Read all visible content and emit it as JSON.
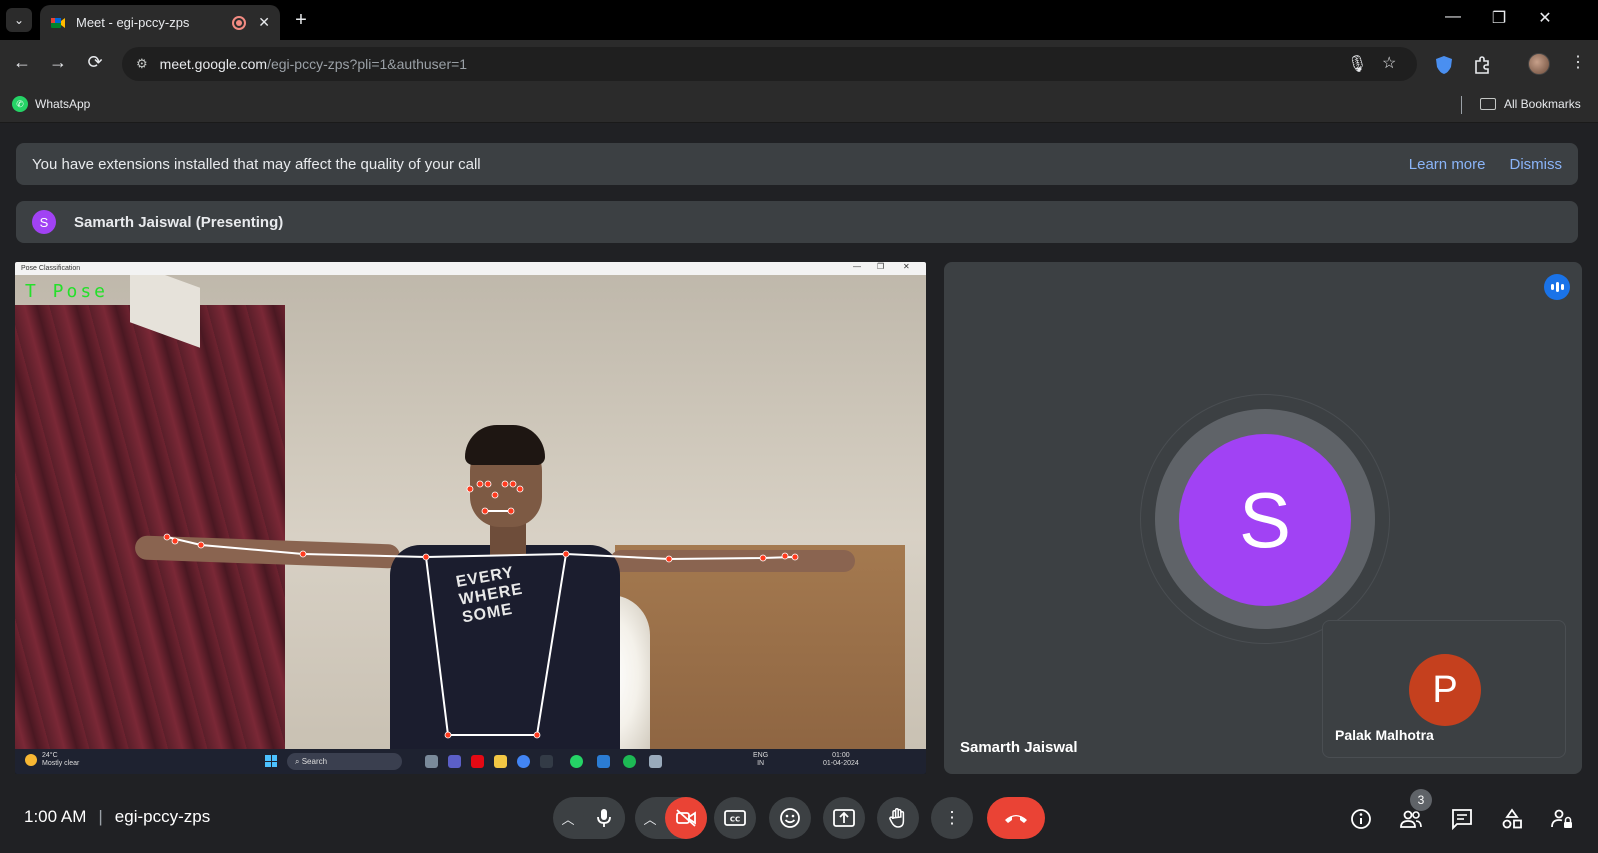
{
  "browser": {
    "tab_title": "Meet - egi-pccy-zps",
    "url_host": "meet.google.com",
    "url_path": "/egi-pccy-zps?pli=1&authuser=1",
    "bookmarks": [
      {
        "label": "WhatsApp"
      }
    ],
    "all_bookmarks_label": "All Bookmarks"
  },
  "banner": {
    "text": "You have extensions installed that may affect the quality of your call",
    "learn_more": "Learn more",
    "dismiss": "Dismiss"
  },
  "presenter": {
    "initial": "S",
    "label": "Samarth Jaiswal (Presenting)"
  },
  "presentation": {
    "window_title": "Pose Classification",
    "pose_label": "T Pose",
    "shirt_text": "EVERY WHERE SOME",
    "taskbar": {
      "temperature": "24°C",
      "weather": "Mostly clear",
      "search": "Search",
      "lang": "ENG",
      "region": "IN",
      "time": "01:00",
      "date": "01-04-2024"
    }
  },
  "participants": [
    {
      "initial": "S",
      "name": "Samarth Jaiswal",
      "avatar_color": "#a142f4",
      "speaking": true
    },
    {
      "initial": "P",
      "name": "Palak Malhotra",
      "avatar_color": "#c5401e"
    }
  ],
  "bottom_bar": {
    "time": "1:00 AM",
    "meeting_code": "egi-pccy-zps",
    "people_count": "3"
  },
  "colors": {
    "accent_red": "#ea4335",
    "link_blue": "#8ab4f8",
    "surface": "#3c4043",
    "background": "#202124",
    "pose_label_green": "#24e02a"
  }
}
